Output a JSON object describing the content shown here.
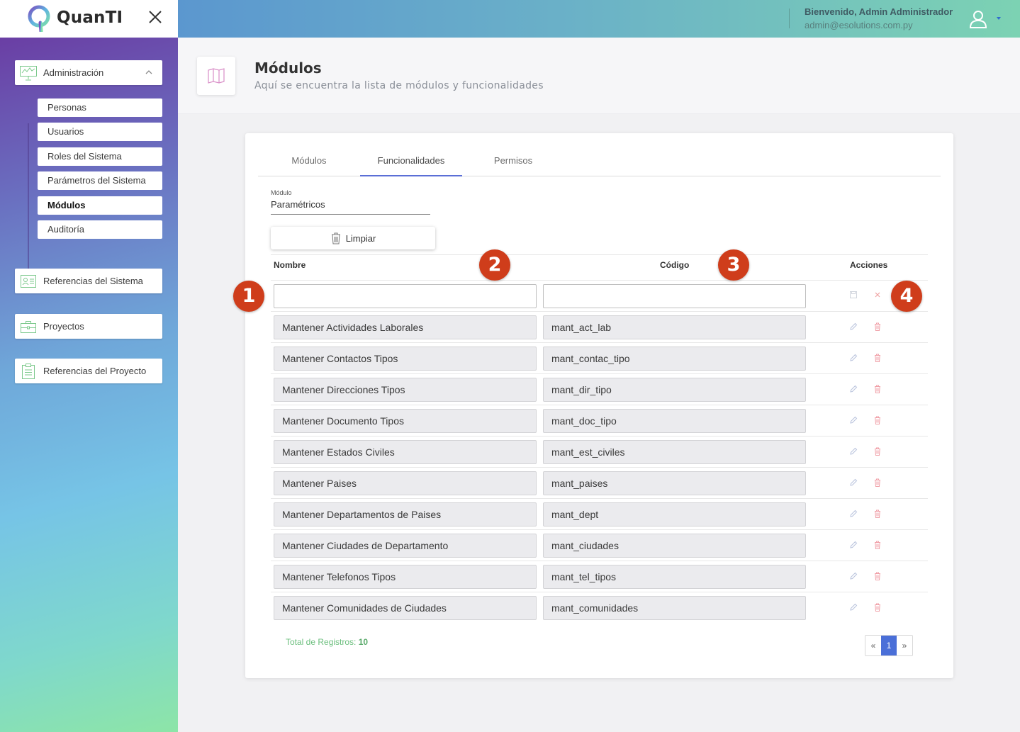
{
  "brand": {
    "name": "QuanTI"
  },
  "header": {
    "welcome": "Bienvenido, Admin Administrador",
    "email": "admin@esolutions.com.py"
  },
  "sidebar": {
    "groups": [
      {
        "label": "Administración",
        "icon": "presentation-chart-icon",
        "expanded": true
      },
      {
        "label": "Referencias del Sistema",
        "icon": "id-card-icon"
      },
      {
        "label": "Proyectos",
        "icon": "briefcase-icon"
      },
      {
        "label": "Referencias del Proyecto",
        "icon": "clipboard-icon"
      }
    ],
    "admin_items": [
      {
        "label": "Personas"
      },
      {
        "label": "Usuarios"
      },
      {
        "label": "Roles del Sistema"
      },
      {
        "label": "Parámetros del Sistema"
      },
      {
        "label": "Módulos",
        "active": true
      },
      {
        "label": "Auditoría"
      }
    ]
  },
  "page": {
    "title": "Módulos",
    "subtitle": "Aquí se encuentra la lista de módulos y funcionalidades",
    "icon": "map-icon"
  },
  "tabs": [
    {
      "label": "Módulos"
    },
    {
      "label": "Funcionalidades",
      "active": true
    },
    {
      "label": "Permisos"
    }
  ],
  "filter": {
    "label": "Módulo",
    "value": "Paramétricos"
  },
  "clear_button": {
    "label": "Limpiar"
  },
  "table": {
    "headers": {
      "name": "Nombre",
      "code": "Código",
      "actions": "Acciones"
    },
    "rows": [
      {
        "name": "Mantener Actividades Laborales",
        "code": "mant_act_lab"
      },
      {
        "name": "Mantener Contactos Tipos",
        "code": "mant_contac_tipo"
      },
      {
        "name": "Mantener Direcciones Tipos",
        "code": "mant_dir_tipo"
      },
      {
        "name": "Mantener Documento Tipos",
        "code": "mant_doc_tipo"
      },
      {
        "name": "Mantener Estados Civiles",
        "code": "mant_est_civiles"
      },
      {
        "name": "Mantener Paises",
        "code": "mant_paises"
      },
      {
        "name": "Mantener Departamentos de Paises",
        "code": "mant_dept"
      },
      {
        "name": "Mantener Ciudades de Departamento",
        "code": "mant_ciudades"
      },
      {
        "name": "Mantener Telefonos Tipos",
        "code": "mant_tel_tipos"
      },
      {
        "name": "Mantener Comunidades de Ciudades",
        "code": "mant_comunidades"
      }
    ]
  },
  "footer": {
    "total_label": "Total de Registros:",
    "total_value": "10"
  },
  "pagination": {
    "prev": "«",
    "current": "1",
    "next": "»"
  },
  "annotations": [
    "1",
    "2",
    "3",
    "4"
  ],
  "colors": {
    "accent": "#5b6fd6",
    "badge": "#cf3d1b",
    "total_green": "#6cbf7e",
    "page_current": "#4a6fd8"
  }
}
